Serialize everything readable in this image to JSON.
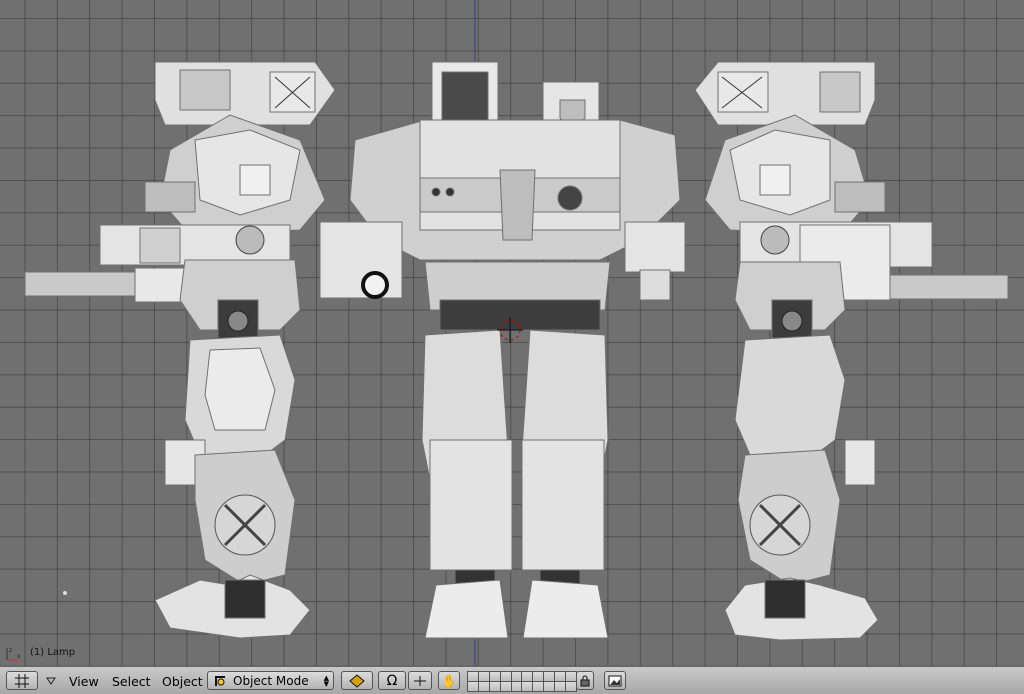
{
  "viewport": {
    "object_label": "(1) Lamp",
    "grid_color": "#3a3a3a",
    "background_color": "#707070"
  },
  "header": {
    "editor_type_icon": "grid-icon",
    "menus": {
      "view": "View",
      "select": "Select",
      "object": "Object"
    },
    "mode": {
      "label": "Object Mode",
      "icon": "object-mode-icon"
    },
    "draw_type_icon": "solid-draw-icon",
    "pivot_icon": "pivot-icon",
    "manipulator_icon": "manipulator-icon",
    "grab_icon": "hand-icon",
    "lock_icon": "lock-icon",
    "render_icon": "render-icon"
  }
}
